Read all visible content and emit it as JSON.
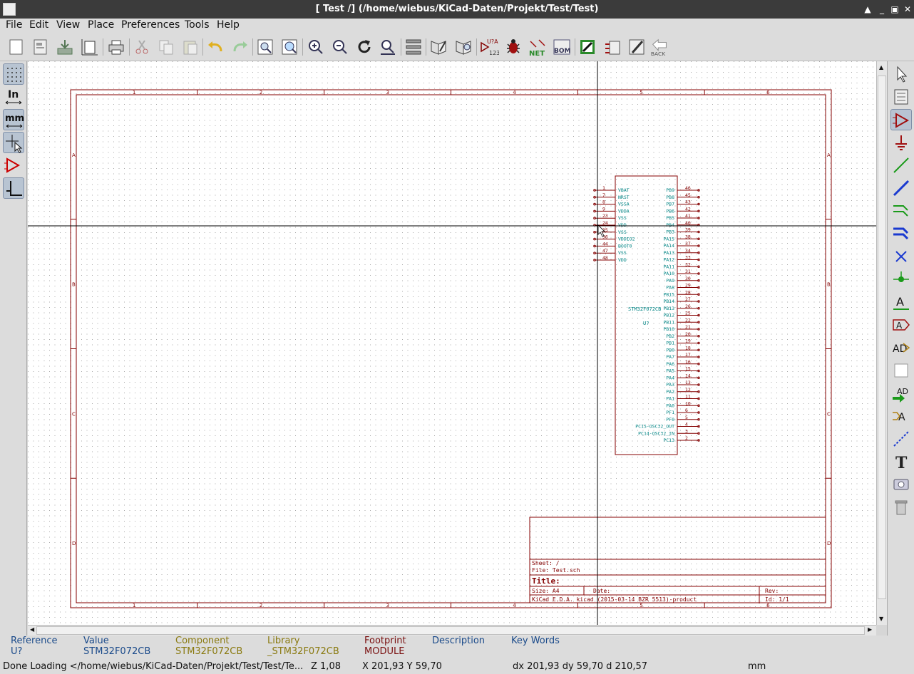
{
  "window": {
    "title": "[ Test /] (/home/wiebus/KiCad-Daten/Projekt/Test/Test)"
  },
  "menu": [
    "File",
    "Edit",
    "View",
    "Place",
    "Preferences",
    "Tools",
    "Help"
  ],
  "toolbar": {
    "icons": [
      "new-sheet-icon",
      "page-settings-icon",
      "load-icon",
      "sheet-size-icon",
      "print-icon",
      "cut-icon",
      "copy-icon",
      "paste-icon",
      "undo-icon",
      "redo-icon",
      "find-icon",
      "find-replace-icon",
      "zoom-in-icon",
      "zoom-out-icon",
      "redraw-icon",
      "zoom-fit-icon",
      "hierarchy-icon",
      "library-editor-icon",
      "library-browser-icon",
      "annotate-icon",
      "erc-icon",
      "netlist-icon",
      "bom-icon",
      "cvpcb-icon",
      "import-footprint-icon",
      "pcbnew-icon",
      "back-icon"
    ],
    "annotate_label": "U?A",
    "annotate_sub": "123",
    "net_label": "NET",
    "bom_label": "BOM",
    "back_label": "BACK"
  },
  "left_tools": {
    "units_in": "In",
    "units_mm": "mm"
  },
  "sheet": {
    "col_labels": [
      "1",
      "2",
      "3",
      "4",
      "5",
      "6"
    ],
    "row_labels": [
      "A",
      "B",
      "C",
      "D"
    ],
    "titleblock": {
      "sheet": "Sheet: /",
      "file": "File: Test.sch",
      "title": "Title:",
      "size": "Size: A4",
      "date": "Date:",
      "rev": "Rev:",
      "kicad": "KiCad E.D.A.  kicad (2015-03-14 BZR 5513)-product",
      "id": "Id: 1/1"
    }
  },
  "component": {
    "name": "STM32F072CB",
    "ref": "U?",
    "left_pins": [
      {
        "num": "1",
        "name": "VBAT"
      },
      {
        "num": "7",
        "name": "NRST"
      },
      {
        "num": "8",
        "name": "VSSA"
      },
      {
        "num": "9",
        "name": "VDDA"
      },
      {
        "num": "23",
        "name": "VSS"
      },
      {
        "num": "24",
        "name": "VDD"
      },
      {
        "num": "35",
        "name": "VSS"
      },
      {
        "num": "36",
        "name": "VDDIO2"
      },
      {
        "num": "44",
        "name": "BOOT0"
      },
      {
        "num": "47",
        "name": "VSS"
      },
      {
        "num": "48",
        "name": "VDD"
      }
    ],
    "right_pins": [
      {
        "num": "46",
        "name": "PB9"
      },
      {
        "num": "45",
        "name": "PB8"
      },
      {
        "num": "43",
        "name": "PB7"
      },
      {
        "num": "42",
        "name": "PB6"
      },
      {
        "num": "41",
        "name": "PB5"
      },
      {
        "num": "40",
        "name": "PB4"
      },
      {
        "num": "39",
        "name": "PB3"
      },
      {
        "num": "38",
        "name": "PA15"
      },
      {
        "num": "37",
        "name": "PA14"
      },
      {
        "num": "34",
        "name": "PA13"
      },
      {
        "num": "33",
        "name": "PA12"
      },
      {
        "num": "32",
        "name": "PA11"
      },
      {
        "num": "31",
        "name": "PA10"
      },
      {
        "num": "30",
        "name": "PA9"
      },
      {
        "num": "29",
        "name": "PA8"
      },
      {
        "num": "28",
        "name": "PB15"
      },
      {
        "num": "27",
        "name": "PB14"
      },
      {
        "num": "26",
        "name": "PB13"
      },
      {
        "num": "25",
        "name": "PB12"
      },
      {
        "num": "22",
        "name": "PB11"
      },
      {
        "num": "21",
        "name": "PB10"
      },
      {
        "num": "20",
        "name": "PB2"
      },
      {
        "num": "19",
        "name": "PB1"
      },
      {
        "num": "18",
        "name": "PB0"
      },
      {
        "num": "17",
        "name": "PA7"
      },
      {
        "num": "16",
        "name": "PA6"
      },
      {
        "num": "15",
        "name": "PA5"
      },
      {
        "num": "14",
        "name": "PA4"
      },
      {
        "num": "13",
        "name": "PA3"
      },
      {
        "num": "12",
        "name": "PA2"
      },
      {
        "num": "11",
        "name": "PA1"
      },
      {
        "num": "10",
        "name": "PA0"
      },
      {
        "num": "6",
        "name": "PF1"
      },
      {
        "num": "5",
        "name": "PF0"
      },
      {
        "num": "4",
        "name": "PC15-OSC32_OUT"
      },
      {
        "num": "3",
        "name": "PC14-OSC32_IN"
      },
      {
        "num": "2",
        "name": "PC13"
      }
    ]
  },
  "info_panel": {
    "reference_label": "Reference",
    "reference_value": "U?",
    "value_label": "Value",
    "value_value": "STM32F072CB",
    "component_label": "Component",
    "component_value": "STM32F072CB",
    "library_label": "Library",
    "library_value": "_STM32F072CB",
    "footprint_label": "Footprint",
    "footprint_value": "MODULE",
    "description_label": "Description",
    "keywords_label": "Key Words"
  },
  "status": {
    "message": "Done Loading </home/wiebus/KiCad-Daten/Projekt/Test/Test/Te...",
    "zoom": "Z 1,08",
    "xy": "X 201,93  Y 59,70",
    "delta": "dx 201,93  dy 59,70  d 210,57",
    "units": "mm"
  },
  "colors": {
    "sheet_border": "#840000",
    "component_body": "#840000",
    "pin_text": "#008484",
    "component_value": "#008484",
    "grid": "#a0a0a0",
    "cursor": "#000000"
  }
}
